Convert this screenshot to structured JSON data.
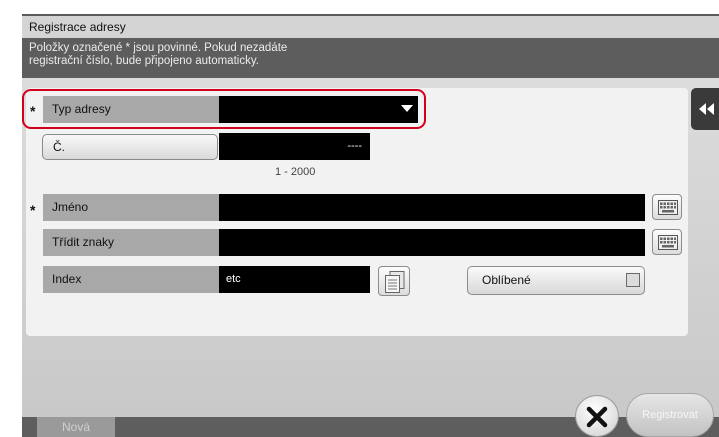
{
  "dialog": {
    "title": "Registrace adresy",
    "info_line1": "Položky označené * jsou povinné. Pokud nezadáte",
    "info_line2": "registrační číslo, bude připojeno automaticky."
  },
  "form": {
    "required_mark": "*",
    "address_type": {
      "label": "Typ adresy",
      "value": ""
    },
    "number": {
      "label": "Č.",
      "value": "----",
      "range": "1 - 2000"
    },
    "name": {
      "label": "Jméno",
      "value": ""
    },
    "sort_chars": {
      "label": "Třídit znaky",
      "value": ""
    },
    "index": {
      "label": "Index",
      "value": "etc"
    },
    "favorite": {
      "label": "Oblíbené",
      "checked": false
    }
  },
  "footer": {
    "new_tab_label": "Nová",
    "register_label": "Registrovat"
  },
  "icons": {
    "side_tab": "double-chevron-left-icon",
    "keyboard": "keyboard-icon",
    "index_list": "index-list-icon",
    "cancel": "close-icon",
    "dropdown": "dropdown-arrow-icon"
  },
  "colors": {
    "highlight": "#d2001c",
    "label_bg": "#a8a8a8",
    "field_bg": "#000000",
    "panel_bg": "#f2f2f2"
  }
}
